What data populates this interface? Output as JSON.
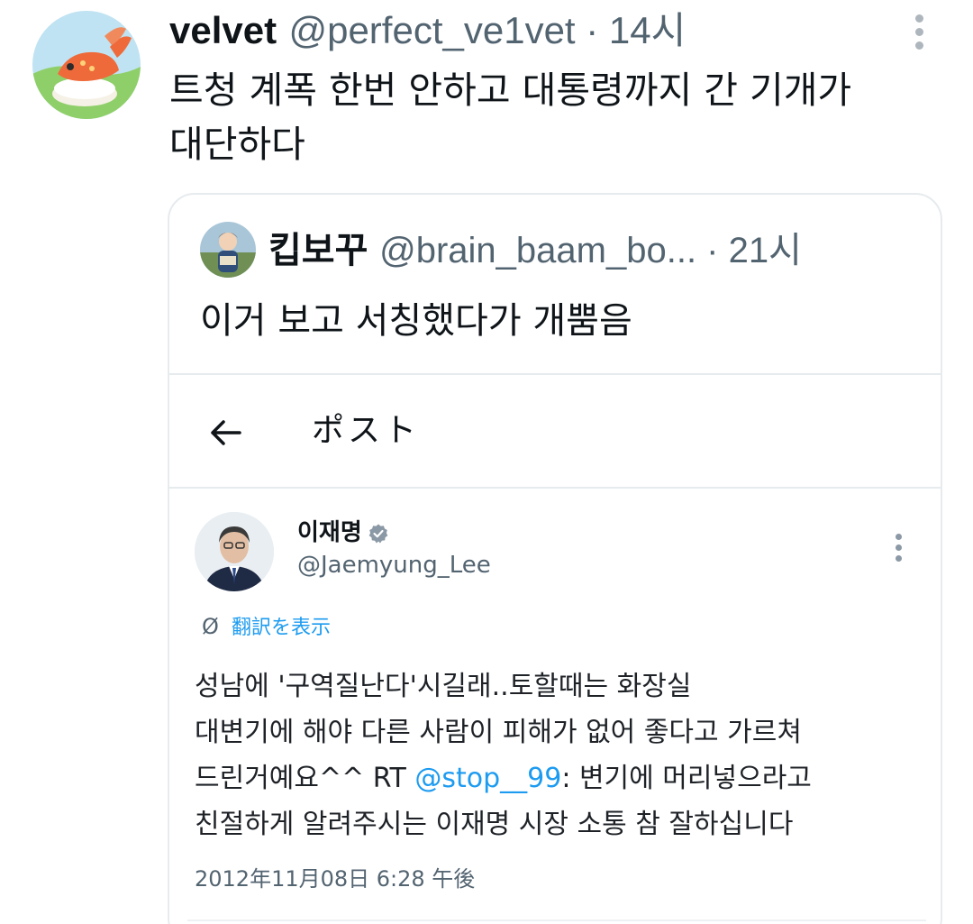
{
  "tweet": {
    "display_name": "velvet",
    "handle": "@perfect_ve1vet",
    "separator": " · ",
    "time": "14시",
    "text_line1": "트청 계폭 한번 안하고 대통령까지 간 기개가",
    "text_line2": "대단하다",
    "icons": {
      "avatar": "koi-fish-sushi-avatar",
      "more": "more-vertical-icon"
    }
  },
  "quote": {
    "display_name": "킵보꾸",
    "handle": "@brain_baam_bo...",
    "separator": " · ",
    "time": "21시",
    "text": "이거 보고 서칭했다가 개뿜음"
  },
  "screenshot": {
    "nav_title": "ポスト",
    "author_name": "이재명",
    "author_handle": "@Jaemyung_Lee",
    "translate_label": "翻訳を表示",
    "body_line1": "성남에 '구역질난다'시길래..토할때는 화장실",
    "body_line2": "대변기에 해야 다른 사람이 피해가 없어 좋다고 가르쳐",
    "body_line3_a": "드린거예요^^ RT ",
    "body_line3_mention": "@stop__99",
    "body_line3_b": ": 변기에 머리넣으라고",
    "body_line4": "친절하게 알려주시는 이재명 시장 소통 참 잘하십니다",
    "date": "2012年11月08日 6:28 午後"
  },
  "colors": {
    "text": "#0f1419",
    "muted": "#536471",
    "link": "#1d9bf0",
    "border": "#e6ebee"
  }
}
